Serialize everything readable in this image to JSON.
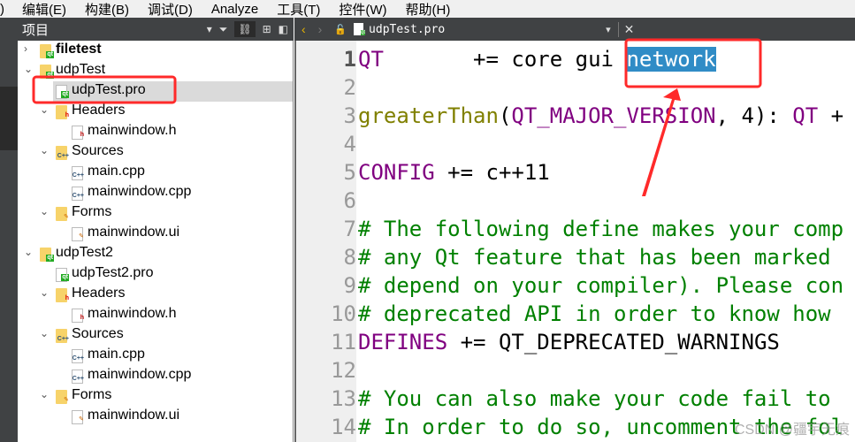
{
  "menu": [
    "编辑(E)",
    "构建(B)",
    "调试(D)",
    "Analyze",
    "工具(T)",
    "控件(W)",
    "帮助(H)"
  ],
  "project_panel": {
    "title": "项目",
    "tools": [
      "filter-icon",
      "link-icon",
      "split-add-icon",
      "close-panel-icon"
    ]
  },
  "tree": [
    {
      "label": "filetest",
      "level": 0,
      "expand": "collapsed",
      "icon": "qt-project-folder",
      "bold": true
    },
    {
      "label": "udpTest",
      "level": 0,
      "expand": "expanded",
      "icon": "qt-project-folder"
    },
    {
      "label": "udpTest.pro",
      "level": 1,
      "icon": "pro-file",
      "selected": true
    },
    {
      "label": "Headers",
      "level": 1,
      "expand": "expanded",
      "icon": "headers-folder"
    },
    {
      "label": "mainwindow.h",
      "level": 2,
      "icon": "h-file"
    },
    {
      "label": "Sources",
      "level": 1,
      "expand": "expanded",
      "icon": "sources-folder"
    },
    {
      "label": "main.cpp",
      "level": 2,
      "icon": "cpp-file"
    },
    {
      "label": "mainwindow.cpp",
      "level": 2,
      "icon": "cpp-file"
    },
    {
      "label": "Forms",
      "level": 1,
      "expand": "expanded",
      "icon": "forms-folder"
    },
    {
      "label": "mainwindow.ui",
      "level": 2,
      "icon": "ui-file"
    },
    {
      "label": "udpTest2",
      "level": 0,
      "expand": "expanded",
      "icon": "qt-project-folder"
    },
    {
      "label": "udpTest2.pro",
      "level": 1,
      "icon": "pro-file"
    },
    {
      "label": "Headers",
      "level": 1,
      "expand": "expanded",
      "icon": "headers-folder"
    },
    {
      "label": "mainwindow.h",
      "level": 2,
      "icon": "h-file"
    },
    {
      "label": "Sources",
      "level": 1,
      "expand": "expanded",
      "icon": "sources-folder"
    },
    {
      "label": "main.cpp",
      "level": 2,
      "icon": "cpp-file"
    },
    {
      "label": "mainwindow.cpp",
      "level": 2,
      "icon": "cpp-file"
    },
    {
      "label": "Forms",
      "level": 1,
      "expand": "expanded",
      "icon": "forms-folder"
    },
    {
      "label": "mainwindow.ui",
      "level": 2,
      "icon": "ui-file"
    }
  ],
  "editor": {
    "filename": "udpTest.pro",
    "current_line": 1,
    "lines": [
      {
        "n": "1",
        "tokens": [
          {
            "t": "QT",
            "c": "k"
          },
          {
            "t": "       += core gui ",
            "c": "p"
          },
          {
            "t": "network",
            "c": "hl"
          }
        ]
      },
      {
        "n": "2",
        "tokens": []
      },
      {
        "n": "3",
        "tokens": [
          {
            "t": "greaterThan",
            "c": "f"
          },
          {
            "t": "(",
            "c": "p"
          },
          {
            "t": "QT_MAJOR_VERSION",
            "c": "k"
          },
          {
            "t": ", 4): ",
            "c": "p"
          },
          {
            "t": "QT",
            "c": "k"
          },
          {
            "t": " +",
            "c": "p"
          }
        ]
      },
      {
        "n": "4",
        "tokens": []
      },
      {
        "n": "5",
        "tokens": [
          {
            "t": "CONFIG",
            "c": "k"
          },
          {
            "t": " += c++11",
            "c": "p"
          }
        ]
      },
      {
        "n": "6",
        "tokens": []
      },
      {
        "n": "7",
        "tokens": [
          {
            "t": "# The following define makes your comp",
            "c": "c"
          }
        ]
      },
      {
        "n": "8",
        "tokens": [
          {
            "t": "# any Qt feature that has been marked",
            "c": "c"
          }
        ]
      },
      {
        "n": "9",
        "tokens": [
          {
            "t": "# depend on your compiler). Please con",
            "c": "c"
          }
        ]
      },
      {
        "n": "10",
        "tokens": [
          {
            "t": "# deprecated API in order to know how",
            "c": "c"
          }
        ]
      },
      {
        "n": "11",
        "tokens": [
          {
            "t": "DEFINES",
            "c": "k"
          },
          {
            "t": " += QT_DEPRECATED_WARNINGS",
            "c": "p"
          }
        ]
      },
      {
        "n": "12",
        "tokens": []
      },
      {
        "n": "13",
        "tokens": [
          {
            "t": "# You can also make your code fail to",
            "c": "c"
          }
        ]
      },
      {
        "n": "14",
        "tokens": [
          {
            "t": "# In order to do so, uncomment the fol",
            "c": "c"
          }
        ]
      }
    ]
  },
  "watermark": "CSDN @疆宇无痕",
  "colors": {
    "keyword": "#800080",
    "function": "#808000",
    "comment": "#008000",
    "selection": "#308cc6",
    "annotation": "#ff2a2a"
  }
}
